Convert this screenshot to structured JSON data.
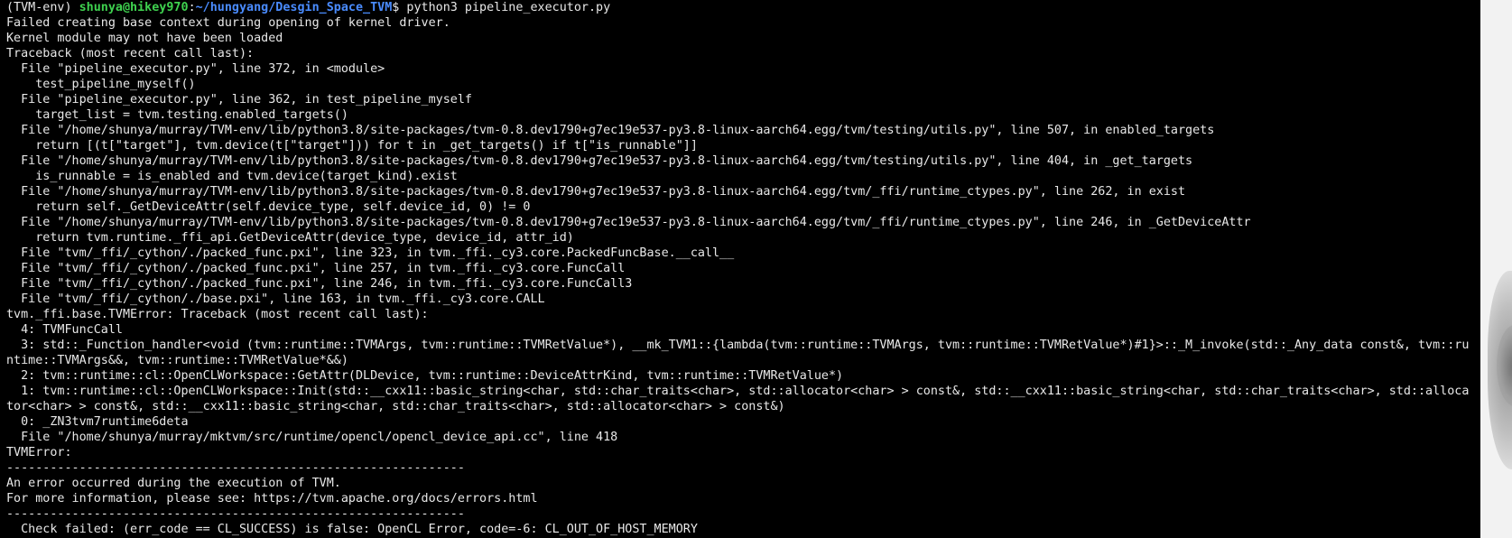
{
  "prompt": {
    "env": "(TVM-env) ",
    "user_host": "shunya@hikey970",
    "separator": ":",
    "path": "~/hungyang/Desgin_Space_TVM",
    "dollar": "$ ",
    "command": "python3 pipeline_executor.py"
  },
  "output_lines": [
    "Failed creating base context during opening of kernel driver.",
    "Kernel module may not have been loaded",
    "Traceback (most recent call last):",
    "  File \"pipeline_executor.py\", line 372, in <module>",
    "    test_pipeline_myself()",
    "  File \"pipeline_executor.py\", line 362, in test_pipeline_myself",
    "    target_list = tvm.testing.enabled_targets()",
    "  File \"/home/shunya/murray/TVM-env/lib/python3.8/site-packages/tvm-0.8.dev1790+g7ec19e537-py3.8-linux-aarch64.egg/tvm/testing/utils.py\", line 507, in enabled_targets",
    "    return [(t[\"target\"], tvm.device(t[\"target\"])) for t in _get_targets() if t[\"is_runnable\"]]",
    "  File \"/home/shunya/murray/TVM-env/lib/python3.8/site-packages/tvm-0.8.dev1790+g7ec19e537-py3.8-linux-aarch64.egg/tvm/testing/utils.py\", line 404, in _get_targets",
    "    is_runnable = is_enabled and tvm.device(target_kind).exist",
    "  File \"/home/shunya/murray/TVM-env/lib/python3.8/site-packages/tvm-0.8.dev1790+g7ec19e537-py3.8-linux-aarch64.egg/tvm/_ffi/runtime_ctypes.py\", line 262, in exist",
    "    return self._GetDeviceAttr(self.device_type, self.device_id, 0) != 0",
    "  File \"/home/shunya/murray/TVM-env/lib/python3.8/site-packages/tvm-0.8.dev1790+g7ec19e537-py3.8-linux-aarch64.egg/tvm/_ffi/runtime_ctypes.py\", line 246, in _GetDeviceAttr",
    "    return tvm.runtime._ffi_api.GetDeviceAttr(device_type, device_id, attr_id)",
    "  File \"tvm/_ffi/_cython/./packed_func.pxi\", line 323, in tvm._ffi._cy3.core.PackedFuncBase.__call__",
    "  File \"tvm/_ffi/_cython/./packed_func.pxi\", line 257, in tvm._ffi._cy3.core.FuncCall",
    "  File \"tvm/_ffi/_cython/./packed_func.pxi\", line 246, in tvm._ffi._cy3.core.FuncCall3",
    "  File \"tvm/_ffi/_cython/./base.pxi\", line 163, in tvm._ffi._cy3.core.CALL",
    "tvm._ffi.base.TVMError: Traceback (most recent call last):",
    "  4: TVMFuncCall",
    "  3: std::_Function_handler<void (tvm::runtime::TVMArgs, tvm::runtime::TVMRetValue*), __mk_TVM1::{lambda(tvm::runtime::TVMArgs, tvm::runtime::TVMRetValue*)#1}>::_M_invoke(std::_Any_data const&, tvm::ru",
    "ntime::TVMArgs&&, tvm::runtime::TVMRetValue*&&)",
    "  2: tvm::runtime::cl::OpenCLWorkspace::GetAttr(DLDevice, tvm::runtime::DeviceAttrKind, tvm::runtime::TVMRetValue*)",
    "  1: tvm::runtime::cl::OpenCLWorkspace::Init(std::__cxx11::basic_string<char, std::char_traits<char>, std::allocator<char> > const&, std::__cxx11::basic_string<char, std::char_traits<char>, std::alloca",
    "tor<char> > const&, std::__cxx11::basic_string<char, std::char_traits<char>, std::allocator<char> > const&)",
    "  0: _ZN3tvm7runtime6deta",
    "  File \"/home/shunya/murray/mktvm/src/runtime/opencl/opencl_device_api.cc\", line 418",
    "TVMError:",
    "---------------------------------------------------------------",
    "An error occurred during the execution of TVM.",
    "For more information, please see: https://tvm.apache.org/docs/errors.html",
    "---------------------------------------------------------------",
    "  Check failed: (err_code == CL_SUCCESS) is false: OpenCL Error, code=-6: CL_OUT_OF_HOST_MEMORY"
  ]
}
